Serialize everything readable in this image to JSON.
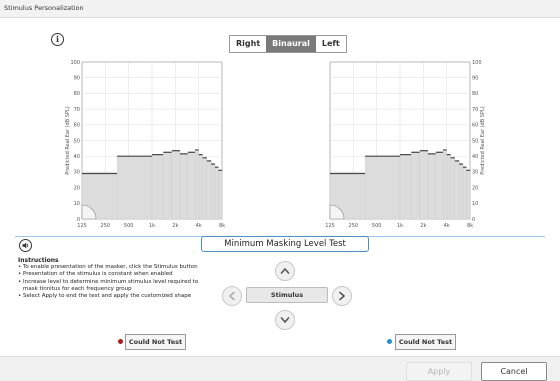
{
  "window": {
    "title": "Stimulus Personalization"
  },
  "ear_selector": {
    "options": [
      {
        "label": "Right",
        "active": false
      },
      {
        "label": "Binaural",
        "active": true
      },
      {
        "label": "Left",
        "active": false
      }
    ]
  },
  "test_title": "Minimum Masking Level Test",
  "instructions": {
    "heading": "Instructions",
    "items": [
      "• To enable presentation of the masker, click the Stimulus button",
      "• Presentation of the stimulus is constant when enabled",
      "• Increase level to determine minimum stimulus level required to mask tinnitus for each frequency group",
      "• Select Apply to end the test and apply the customized shape"
    ]
  },
  "controls": {
    "stimulus_label": "Stimulus",
    "could_not_test_right": "Could Not Test",
    "could_not_test_left": "Could Not Test"
  },
  "footer": {
    "apply_label": "Apply",
    "cancel_label": "Cancel"
  },
  "colors": {
    "accent_blue": "#1f8fd6",
    "right_ear_red": "#a91c1c",
    "active_segment": "#7a7a7a",
    "field_border": "#4a90c8"
  },
  "icons": [
    "info-icon",
    "speaker-icon",
    "chevron-up-icon",
    "chevron-down-icon",
    "chevron-left-icon",
    "chevron-right-icon"
  ],
  "chart_data": [
    {
      "type": "bar",
      "ear": "right",
      "ylabel": "Predicted Real Ear (dB SPL)",
      "ylim": [
        0,
        100
      ],
      "y_ticks": [
        "0",
        "10",
        "20",
        "30",
        "40",
        "50",
        "60",
        "70",
        "80",
        "90",
        "100"
      ],
      "x_ticks": [
        "125",
        "250",
        "500",
        "1k",
        "2k",
        "4k",
        "8k"
      ],
      "grid": true,
      "y_axis_side": "left",
      "bars": [
        {
          "from": 125,
          "to": 355,
          "value": 29
        },
        {
          "from": 355,
          "to": 1000,
          "value": 40
        },
        {
          "from": 1000,
          "to": 1400,
          "value": 41
        },
        {
          "from": 1400,
          "to": 1800,
          "value": 42.5
        },
        {
          "from": 1800,
          "to": 2300,
          "value": 43.5
        },
        {
          "from": 2300,
          "to": 2900,
          "value": 41.5
        },
        {
          "from": 2900,
          "to": 3600,
          "value": 42.5
        },
        {
          "from": 3600,
          "to": 4000,
          "value": 44
        },
        {
          "from": 4000,
          "to": 4500,
          "value": 41
        },
        {
          "from": 4500,
          "to": 5100,
          "value": 39
        },
        {
          "from": 5100,
          "to": 5800,
          "value": 37
        },
        {
          "from": 5800,
          "to": 6500,
          "value": 35
        },
        {
          "from": 6500,
          "to": 7200,
          "value": 33
        },
        {
          "from": 7200,
          "to": 8000,
          "value": 31
        }
      ]
    },
    {
      "type": "bar",
      "ear": "left",
      "ylabel": "Predicted Real Ear (dB SPL)",
      "ylim": [
        0,
        100
      ],
      "y_ticks": [
        "0",
        "10",
        "20",
        "30",
        "40",
        "50",
        "60",
        "70",
        "80",
        "90",
        "100"
      ],
      "x_ticks": [
        "125",
        "250",
        "500",
        "1k",
        "2k",
        "4k",
        "8k"
      ],
      "grid": true,
      "y_axis_side": "right",
      "bars": [
        {
          "from": 125,
          "to": 355,
          "value": 29
        },
        {
          "from": 355,
          "to": 1000,
          "value": 40
        },
        {
          "from": 1000,
          "to": 1400,
          "value": 41
        },
        {
          "from": 1400,
          "to": 1800,
          "value": 42.5
        },
        {
          "from": 1800,
          "to": 2300,
          "value": 43.5
        },
        {
          "from": 2300,
          "to": 2900,
          "value": 41.5
        },
        {
          "from": 2900,
          "to": 3600,
          "value": 42.5
        },
        {
          "from": 3600,
          "to": 4000,
          "value": 44
        },
        {
          "from": 4000,
          "to": 4500,
          "value": 41
        },
        {
          "from": 4500,
          "to": 5100,
          "value": 39
        },
        {
          "from": 5100,
          "to": 5800,
          "value": 37
        },
        {
          "from": 5800,
          "to": 6500,
          "value": 35
        },
        {
          "from": 6500,
          "to": 7200,
          "value": 33
        },
        {
          "from": 7200,
          "to": 8000,
          "value": 31
        }
      ]
    }
  ]
}
